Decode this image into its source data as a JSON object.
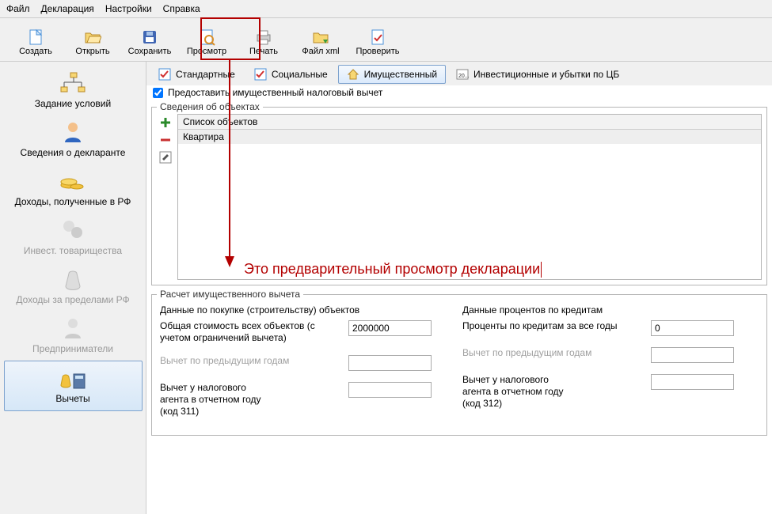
{
  "menu": {
    "file": "Файл",
    "decl": "Декларация",
    "settings": "Настройки",
    "help": "Справка"
  },
  "toolbar": {
    "create": "Создать",
    "open": "Открыть",
    "save": "Сохранить",
    "preview": "Просмотр",
    "print": "Печать",
    "xml": "Файл xml",
    "check": "Проверить"
  },
  "sidebar": {
    "items": [
      {
        "label": "Задание условий"
      },
      {
        "label": "Сведения о декларанте"
      },
      {
        "label": "Доходы, полученные в РФ"
      },
      {
        "label": "Инвест. товарищества"
      },
      {
        "label": "Доходы за пределами РФ"
      },
      {
        "label": "Предприниматели"
      },
      {
        "label": "Вычеты"
      }
    ]
  },
  "tabs": {
    "standard": "Стандартные",
    "social": "Социальные",
    "property": "Имущественный",
    "invest": "Инвестиционные и убытки по ЦБ",
    "invest_badge": "20..."
  },
  "checkbox": {
    "label": "Предоставить имущественный налоговый вычет"
  },
  "objects": {
    "legend": "Сведения об объектах",
    "header": "Список объектов",
    "rows": [
      "Квартира"
    ]
  },
  "annotation": "Это предварительный просмотр декларации",
  "calc": {
    "legend": "Расчет имущественного вычета",
    "left": {
      "title": "Данные по покупке (строительству) объектов",
      "r1": "Общая стоимость всех объектов (с учетом ограничений вычета)",
      "v1": "2000000",
      "r2": "Вычет по предыдущим годам",
      "v2": "",
      "r3_a": "Вычет у налогового",
      "r3_b": "агента в отчетном году",
      "r3_c": "(код 311)",
      "v3": ""
    },
    "right": {
      "title": "Данные процентов по кредитам",
      "r1": "Проценты по кредитам за все годы",
      "v1": "0",
      "r2": "Вычет по предыдущим годам",
      "v2": "",
      "r3_a": "Вычет у налогового",
      "r3_b": "агента в отчетном году",
      "r3_c": "(код 312)",
      "v3": ""
    }
  }
}
